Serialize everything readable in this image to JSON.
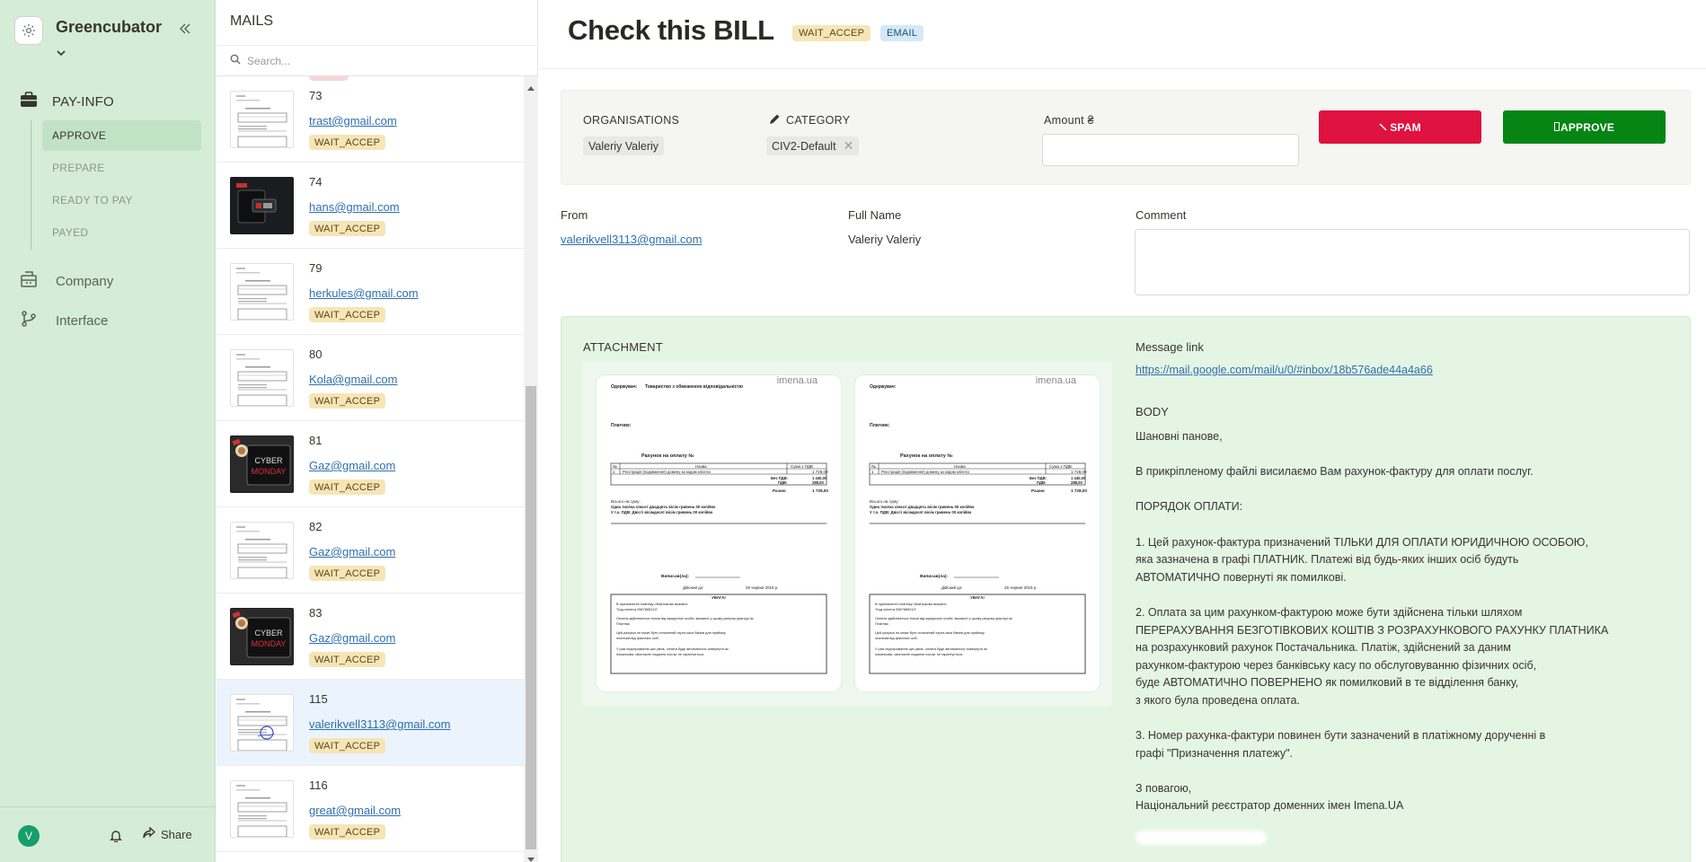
{
  "sidebar": {
    "workspace": "Greencubator",
    "section_label": "PAY-INFO",
    "sub_items": [
      "APPROVE",
      "PREPARE",
      "READY TO PAY",
      "PAYED"
    ],
    "nav_items": [
      "Company",
      "Interface"
    ],
    "avatar_letter": "V",
    "share_label": "Share"
  },
  "mails": {
    "title": "MAILS",
    "search_placeholder": "Search...",
    "rows": [
      {
        "num": "73",
        "email": "trast@gmail.com",
        "status": "WAIT_ACCEP",
        "thumb": "document"
      },
      {
        "num": "74",
        "email": "hans@gmail.com",
        "status": "WAIT_ACCEP",
        "thumb": "dark-screenshot"
      },
      {
        "num": "79",
        "email": "herkules@gmail.com",
        "status": "WAIT_ACCEP",
        "thumb": "document"
      },
      {
        "num": "80",
        "email": "Kola@gmail.com",
        "status": "WAIT_ACCEP",
        "thumb": "document"
      },
      {
        "num": "81",
        "email": "Gaz@gmail.com",
        "status": "WAIT_ACCEP",
        "thumb": "cyber-monday-photo"
      },
      {
        "num": "82",
        "email": "Gaz@gmail.com",
        "status": "WAIT_ACCEP",
        "thumb": "document"
      },
      {
        "num": "83",
        "email": "Gaz@gmail.com",
        "status": "WAIT_ACCEP",
        "thumb": "cyber-monday-photo"
      },
      {
        "num": "115",
        "email": "valerikvell3113@gmail.com",
        "status": "WAIT_ACCEP",
        "thumb": "document-stamped",
        "selected": true
      },
      {
        "num": "116",
        "email": "great@gmail.com",
        "status": "WAIT_ACCEP",
        "thumb": "document"
      }
    ]
  },
  "detail": {
    "title": "Check this BILL",
    "tags": [
      "WAIT_ACCEP",
      "EMAIL"
    ],
    "organisations_label": "ORGANISATIONS",
    "organisation_value": "Valeriy Valeriy",
    "category_label": "CATEGORY",
    "category_value": "CIV2-Default",
    "amount_label": "Amount ₴",
    "amount_value": "",
    "spam_label": "SPAM",
    "approve_label": "APPROVE",
    "from_label": "From",
    "from_value": "valerikvell3113@gmail.com",
    "fullname_label": "Full Name",
    "fullname_value": "Valeriy Valeriy",
    "comment_label": "Comment",
    "comment_value": "",
    "attachment_label": "ATTACHMENT",
    "message_link_label": "Message link",
    "message_link": "https://mail.google.com/mail/u/0/#inbox/18b576ade44a4a66",
    "body_label": "BODY",
    "body_lines": [
      "Шановні панове,",
      "",
      "В прикріпленому файлі висилаємо Вам рахунок-фактуру для оплати послуг.",
      "",
      "ПОРЯДОК ОПЛАТИ:",
      "",
      "1. Цей рахунок-фактура призначений ТІЛЬКИ ДЛЯ ОПЛАТИ ЮРИДИЧНОЮ ОСОБОЮ,",
      "яка зазначена в графі ПЛАТНИК. Платежі від будь-яких інших осіб будуть",
      "АВТОМАТИЧНО повернуті як помилкові.",
      "",
      "2. Оплата за цим рахунком-фактурою може бути здійснена тільки шляхом",
      "ПЕРЕРАХУВАННЯ БЕЗГОТІВКОВИХ КОШТІВ З РОЗРАХУНКОВОГО РАХУНКУ ПЛАТНИКА",
      "на розрахунковий рахунок Постачальника. Платіж, здійснений за даним",
      "рахунком-фактурою через банківську касу по обслуговуванню фізичних осіб,",
      "буде АВТОМАТИЧНО ПОВЕРНЕНО як помилковий в те відділення банку,",
      "з якого була проведена оплата.",
      "",
      "3. Номер рахунка-фактури повинен бути зазначений в платіжному дорученні в",
      "графі \"Призначення платежу\".",
      "",
      "З повагою,",
      "Національний реєстратор доменних імен Imena.UA"
    ],
    "invoice_docs": [
      {
        "brand": "imena.ua",
        "supplier_label": "Одержувач:",
        "supplier": "Товариство з обмеженою відповідальністю",
        "payer_label": "Платник:",
        "heading": "Рахунок на оплату №",
        "col_no": "№",
        "col_name": "Назва",
        "col_sum": "Сума з ПДВ",
        "item_no": "1",
        "item_name": "Реєстрація (подовження) домену за кодом клієнта",
        "item_sum": "1 728,00",
        "no_vat_label": "Без ПДВ:",
        "no_vat": "1 440,00",
        "vat_label": "ПДВ:",
        "vat": "288,00",
        "total_label": "Разом:",
        "total": "1 728,00",
        "words_label": "Всього на суму:",
        "words_1": "Одна тисяча сімсот двадцять вісім гривень 00 копійок",
        "words_2": "У т.ч. ПДВ: Двісті вісімдесят вісім гривень 00 копійок",
        "issued_label": "Виписав(ла):",
        "valid_label": "Дійсний до:",
        "valid_date": "25 червня 2019 р.",
        "notice_title": "УВАГА!",
        "notice_1": "В призначенні платежу обов'язково вказати:",
        "notice_2": "\"Код клієнта 0987665213\"",
        "notice_3": "Оплата здійснюється тільки від юридичної особи, вказаної у цьому рахунку-фактурі як",
        "notice_4": "Платник.",
        "notice_5": "Цей рахунок не може бути сплачений через каси банків для прийому",
        "notice_6": "платежів від фізичних осіб.",
        "notice_7": "У разі недотримання цих умов, оплата буде автоматично повернута як",
        "notice_8": "помилкова, своєчасне надання послуг не гарантується."
      },
      {
        "brand": "imena.ua",
        "supplier_label": "Одержувач:",
        "supplier": "",
        "payer_label": "Платник:",
        "heading": "Рахунок на оплату №",
        "col_no": "№",
        "col_name": "Назва",
        "col_sum": "Сума з ПДВ",
        "item_no": "1",
        "item_name": "Реєстрація (подовження) домену за кодом клієнта",
        "item_sum": "1 728,00",
        "no_vat_label": "Без ПДВ:",
        "no_vat": "1 440,00",
        "vat_label": "ПДВ:",
        "vat": "288,00",
        "total_label": "Разом:",
        "total": "1 728,00",
        "words_label": "Всього на суму:",
        "words_1": "Одна тисяча сімсот двадцять вісім гривень 00 копійок",
        "words_2": "У т.ч. ПДВ: Двісті вісімдесят вісім гривень 00 копійок",
        "issued_label": "Виписав(ла):",
        "valid_label": "Дійсний до:",
        "valid_date": "25 червня 2019 р.",
        "notice_title": "УВАГА!",
        "notice_1": "В призначенні платежу обов'язково вказати:",
        "notice_2": "\"Код клієнта 0987665213\"",
        "notice_3": "Оплата здійснюється тільки від юридичної особи, вказаної у цьому рахунку-фактурі як",
        "notice_4": "Платник.",
        "notice_5": "Цей рахунок не може бути сплачений через каси банків для прийому",
        "notice_6": "платежів від фізичних осіб.",
        "notice_7": "У разі недотримання цих умов, оплата буде автоматично повернута як",
        "notice_8": "помилкова, своєчасне надання послуг не гарантується."
      }
    ]
  },
  "colors": {
    "sidebar_bg": "#d5ecd7",
    "active_sub_bg": "#c2e2c5",
    "spam": "#e0123f",
    "approve": "#068515",
    "attachment_bg": "#e4f5e4",
    "wait_badge": "#f6e5b6",
    "email_tag": "#d3e9f7",
    "link": "#2f6fb0"
  }
}
